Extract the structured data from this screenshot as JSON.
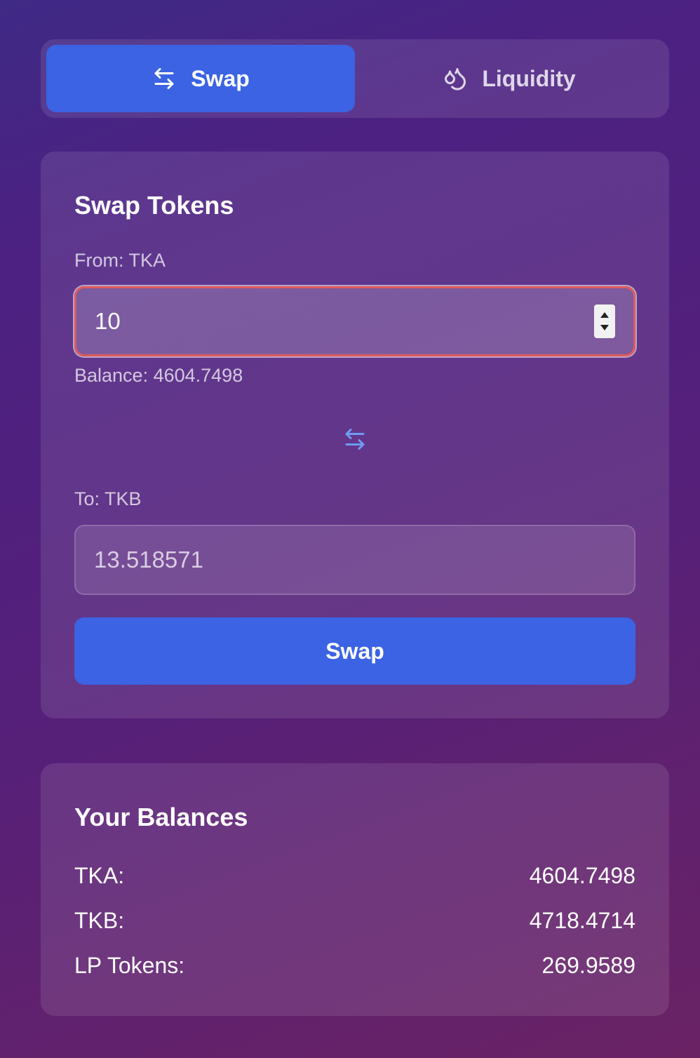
{
  "tabs": [
    {
      "label": "Swap",
      "icon": "swap-arrows-icon",
      "active": true
    },
    {
      "label": "Liquidity",
      "icon": "droplets-icon",
      "active": false
    }
  ],
  "swap_card": {
    "title": "Swap Tokens",
    "from_label": "From: TKA",
    "from_value": "10",
    "balance_text": "Balance: 4604.7498",
    "to_label": "To: TKB",
    "to_value": "13.518571",
    "button_label": "Swap"
  },
  "balances_card": {
    "title": "Your Balances",
    "rows": [
      {
        "label": "TKA:",
        "value": "4604.7498"
      },
      {
        "label": "TKB:",
        "value": "4718.4714"
      },
      {
        "label": "LP Tokens:",
        "value": "269.9589"
      }
    ]
  },
  "colors": {
    "accent": "#3b63e3",
    "focus_border": "#e05a5a",
    "swap_icon": "#6f9bf2"
  }
}
